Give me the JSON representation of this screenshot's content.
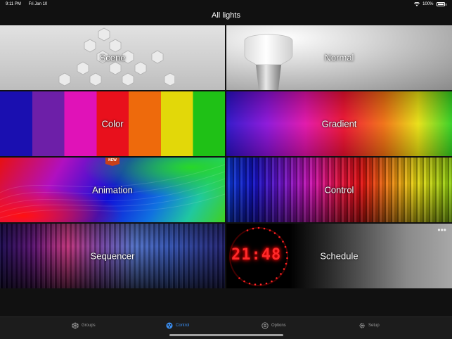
{
  "status_bar": {
    "time": "9:11 PM",
    "date": "Fri Jan 10",
    "battery": "100%",
    "wifi_icon": "wifi-icon",
    "battery_icon": "battery-icon"
  },
  "header": {
    "title": "All lights"
  },
  "tiles": [
    {
      "label": "Scene"
    },
    {
      "label": "Normal"
    },
    {
      "label": "Color"
    },
    {
      "label": "Gradient"
    },
    {
      "label": "Animation",
      "badge": "NEW"
    },
    {
      "label": "Control"
    },
    {
      "label": "Sequencer"
    },
    {
      "label": "Schedule",
      "clock_digits": "21:48",
      "more_icon": "ellipsis-icon"
    }
  ],
  "tab_bar": {
    "active": "Control",
    "accent_color": "#3a8df0",
    "tabs": [
      {
        "label": "Groups",
        "icon": "groups-icon"
      },
      {
        "label": "Control",
        "icon": "control-icon"
      },
      {
        "label": "Options",
        "icon": "options-icon"
      },
      {
        "label": "Setup",
        "icon": "gear-icon"
      }
    ]
  }
}
